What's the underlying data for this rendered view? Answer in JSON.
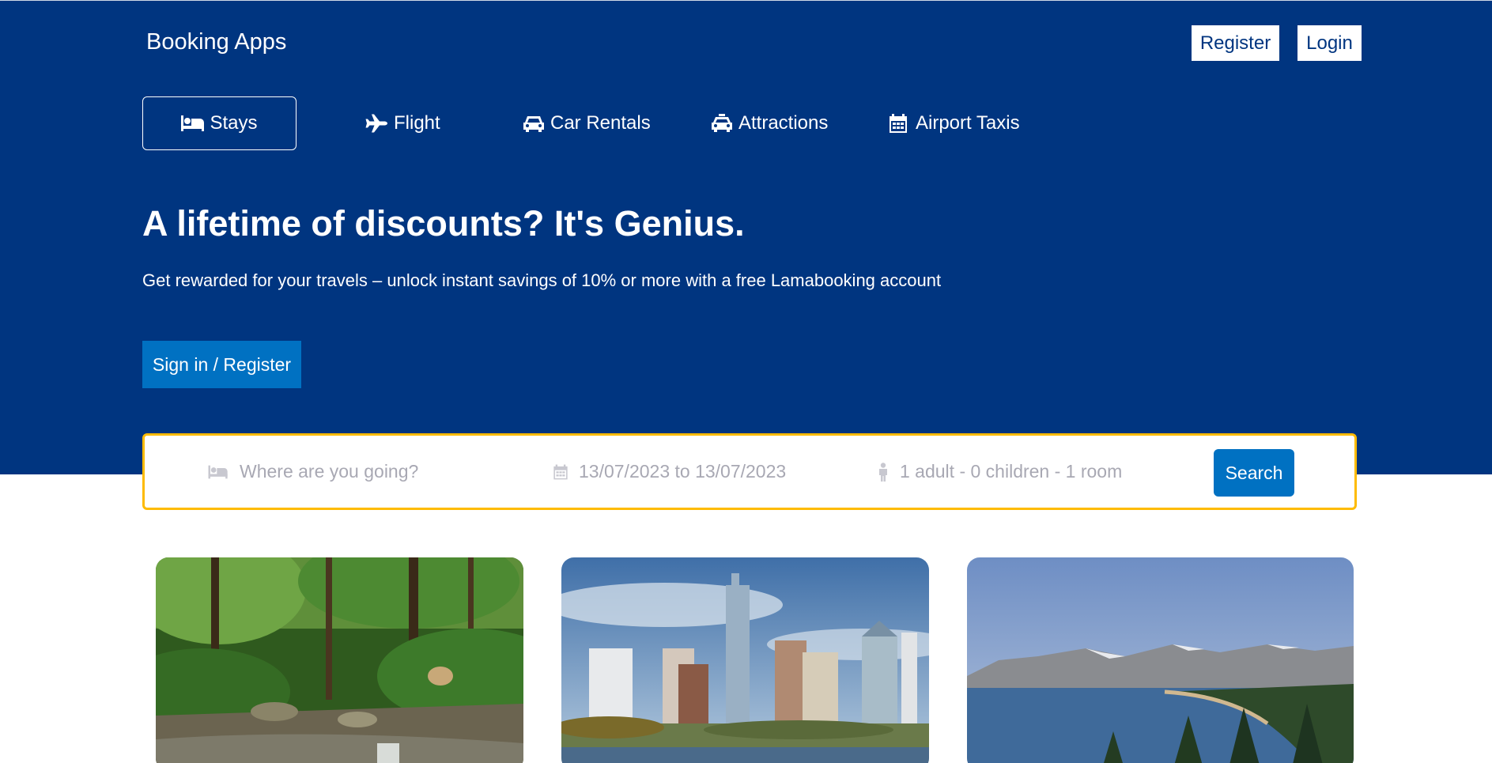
{
  "header": {
    "brand": "Booking Apps",
    "register_label": "Register",
    "login_label": "Login"
  },
  "nav": {
    "items": [
      {
        "label": "Stays",
        "icon": "bed-icon"
      },
      {
        "label": "Flight",
        "icon": "plane-icon"
      },
      {
        "label": "Car Rentals",
        "icon": "car-icon"
      },
      {
        "label": "Attractions",
        "icon": "taxi-icon"
      },
      {
        "label": "Airport Taxis",
        "icon": "calendar-icon"
      }
    ]
  },
  "hero": {
    "headline": "A lifetime of discounts? It's Genius.",
    "subline": "Get rewarded for your travels – unlock instant savings of 10% or more with a free Lamabooking account",
    "signin_label": "Sign in / Register"
  },
  "search": {
    "destination_placeholder": "Where are you going?",
    "dates": "13/07/2023 to 13/07/2023",
    "guests": "1 adult - 0 children - 1 room",
    "button_label": "Search"
  },
  "colors": {
    "brand_blue": "#003580",
    "action_blue": "#0071c2",
    "search_border": "#febb02"
  },
  "featured": [
    {
      "image": "forest-creek-image"
    },
    {
      "image": "city-skyline-image"
    },
    {
      "image": "mountain-lake-image"
    }
  ]
}
